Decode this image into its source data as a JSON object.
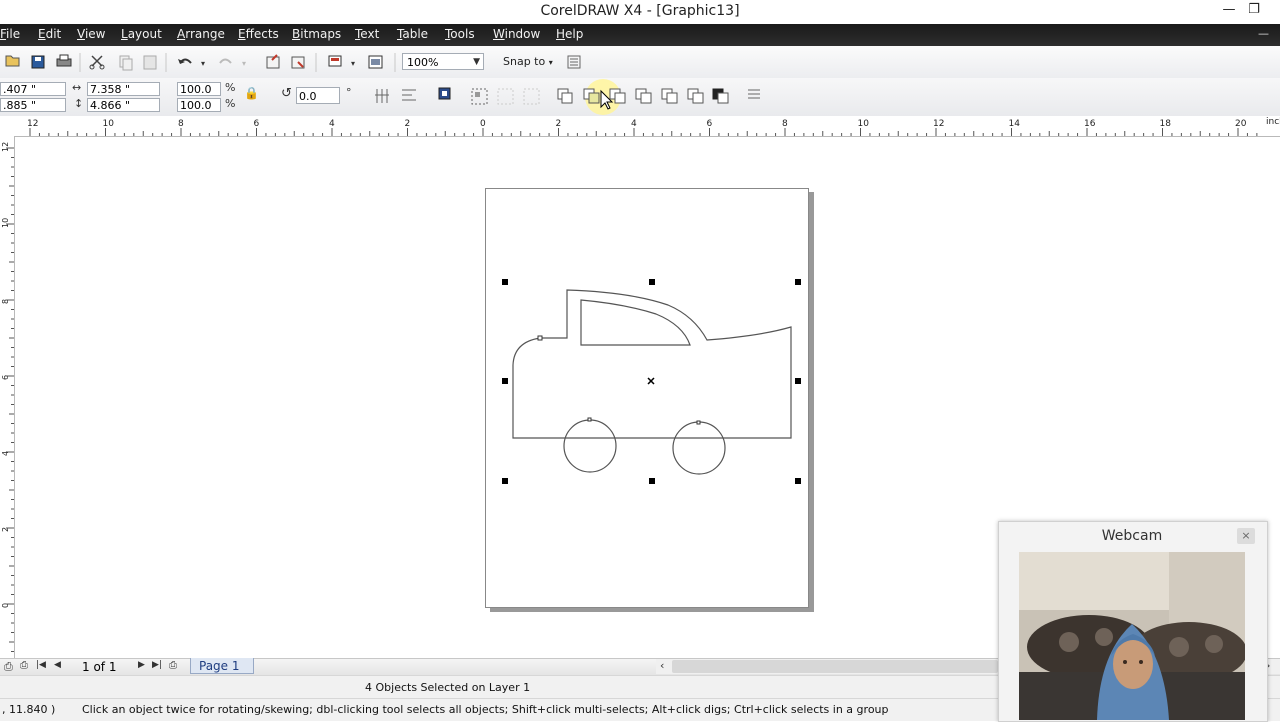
{
  "window": {
    "title": "CorelDRAW X4 - [Graphic13]"
  },
  "menu": [
    {
      "label": "File",
      "mnemonic": "F",
      "rest": "ile"
    },
    {
      "label": "Edit",
      "mnemonic": "E",
      "rest": "dit"
    },
    {
      "label": "View",
      "mnemonic": "V",
      "rest": "iew"
    },
    {
      "label": "Layout",
      "mnemonic": "L",
      "rest": "ayout"
    },
    {
      "label": "Arrange",
      "mnemonic": "A",
      "rest": "rrange"
    },
    {
      "label": "Effects",
      "mnemonic": "E",
      "rest": "ffects"
    },
    {
      "label": "Bitmaps",
      "mnemonic": "B",
      "rest": "itmaps"
    },
    {
      "label": "Text",
      "mnemonic": "T",
      "rest": "ext"
    },
    {
      "label": "Table",
      "mnemonic": "T",
      "rest": "able"
    },
    {
      "label": "Tools",
      "mnemonic": "T",
      "rest": "ools"
    },
    {
      "label": "Window",
      "mnemonic": "W",
      "rest": "indow"
    },
    {
      "label": "Help",
      "mnemonic": "H",
      "rest": "elp"
    }
  ],
  "toolbar": {
    "zoom": "100%",
    "snap_to": "Snap to"
  },
  "properties": {
    "x_value": ".407 \"",
    "y_value": ".885 \"",
    "width_value": "7.358 \"",
    "height_value": "4.866 \"",
    "scale_x": "100.0",
    "scale_y": "100.0",
    "percent": "%",
    "rotation": "0.0",
    "degree": "°"
  },
  "rulers": {
    "horizontal_labels": [
      "12",
      "10",
      "8",
      "6",
      "4",
      "2",
      "0",
      "2",
      "4",
      "6",
      "8",
      "10",
      "12",
      "14",
      "16",
      "18",
      "20"
    ],
    "unit": "inches",
    "vertical_labels": [
      "12",
      "10",
      "8",
      "6",
      "4",
      "2",
      "0"
    ]
  },
  "page_nav": {
    "count": "1 of 1",
    "tab": "Page 1"
  },
  "status": {
    "selection": "4 Objects Selected on Layer 1",
    "coords": ", 11.840 )",
    "hint": "Click an object twice for rotating/skewing; dbl-clicking tool selects all objects; Shift+click multi-selects; Alt+click digs; Ctrl+click selects in a group"
  },
  "webcam": {
    "title": "Webcam",
    "close": "×"
  },
  "colors": {
    "menubar_bg": "#222222",
    "highlight": "#fff59a",
    "page_tab_text": "#1f3d80"
  }
}
